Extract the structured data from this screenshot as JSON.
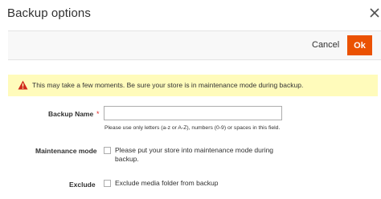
{
  "modal": {
    "title": "Backup options"
  },
  "actions": {
    "cancel_label": "Cancel",
    "ok_label": "Ok"
  },
  "warning": {
    "text": "This may take a few moments. Be sure your store is in maintenance mode during backup."
  },
  "form": {
    "backup_name": {
      "label": "Backup Name",
      "required_mark": "*",
      "value": "",
      "note": "Please use only letters (a-z or A-Z), numbers (0-9) or spaces in this field."
    },
    "maintenance_mode": {
      "label": "Maintenance mode",
      "checkbox_text_line1": "Please put your store into maintenance mode during",
      "checkbox_text_line2": "backup.",
      "checked": false
    },
    "exclude": {
      "label": "Exclude",
      "checkbox_text": "Exclude media folder from backup",
      "checked": false
    }
  },
  "colors": {
    "accent": "#eb5202",
    "warning_bg": "#fffbbb",
    "warning_icon": "#d0281b",
    "required": "#e22626"
  },
  "icons": {
    "close": "close-icon",
    "warning": "warning-triangle-icon"
  }
}
